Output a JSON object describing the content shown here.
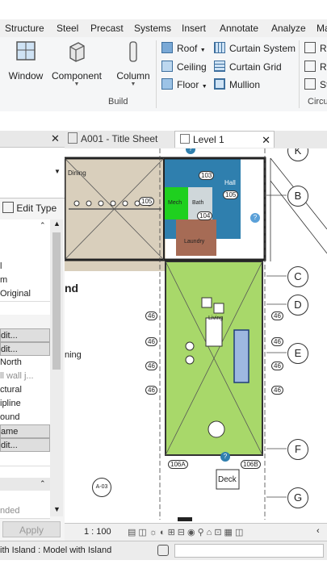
{
  "ribbon_tabs": [
    "Structure",
    "Steel",
    "Precast",
    "Systems",
    "Insert",
    "Annotate",
    "Analyze",
    "Ma"
  ],
  "ribbon": {
    "big_buttons": [
      "Window",
      "Component",
      "Column"
    ],
    "small_buttons": [
      "Roof",
      "Ceiling",
      "Floor",
      "Curtain System",
      "Curtain Grid",
      "Mullion"
    ],
    "right_cut": [
      "Ra",
      "Ra",
      "St"
    ],
    "panel_build": "Build",
    "panel_circ": "Circu"
  },
  "properties": {
    "view_name_fragment": "Dining",
    "edit_type": "Edit Type",
    "rows": [
      "l",
      "m",
      "Original",
      "",
      "dit...",
      "dit...",
      "North",
      "ll wall j...",
      "ctural",
      "ipline",
      "ound",
      "ame",
      "dit...",
      "",
      "",
      "nded"
    ],
    "apply": "Apply"
  },
  "view_tabs": [
    {
      "label": "A001 - Title Sheet",
      "active": false
    },
    {
      "label": "Level 1",
      "active": true
    }
  ],
  "canvas": {
    "nd_text": "nd",
    "ning_text": "ning",
    "grid_letters": [
      "B",
      "C",
      "D",
      "E",
      "F",
      "G"
    ],
    "grid_top_letter": "K",
    "room_labels": [
      "Dining",
      "Hall",
      "Mech",
      "Bath",
      "Laundry",
      "Living",
      "Deck"
    ],
    "tag_texts": [
      "105",
      "103",
      "104",
      "105",
      "106A",
      "106B",
      "46"
    ],
    "section_tag": "A-03"
  },
  "viewbar": {
    "scale": "1 : 100"
  },
  "statusbar": {
    "text": "ith Island : Model with Island"
  },
  "colors": {
    "tan": "#d9cfbc",
    "blue": "#2f7fae",
    "green": "#1fd01f",
    "brown": "#a66b55",
    "lawn": "#a8d86a"
  }
}
